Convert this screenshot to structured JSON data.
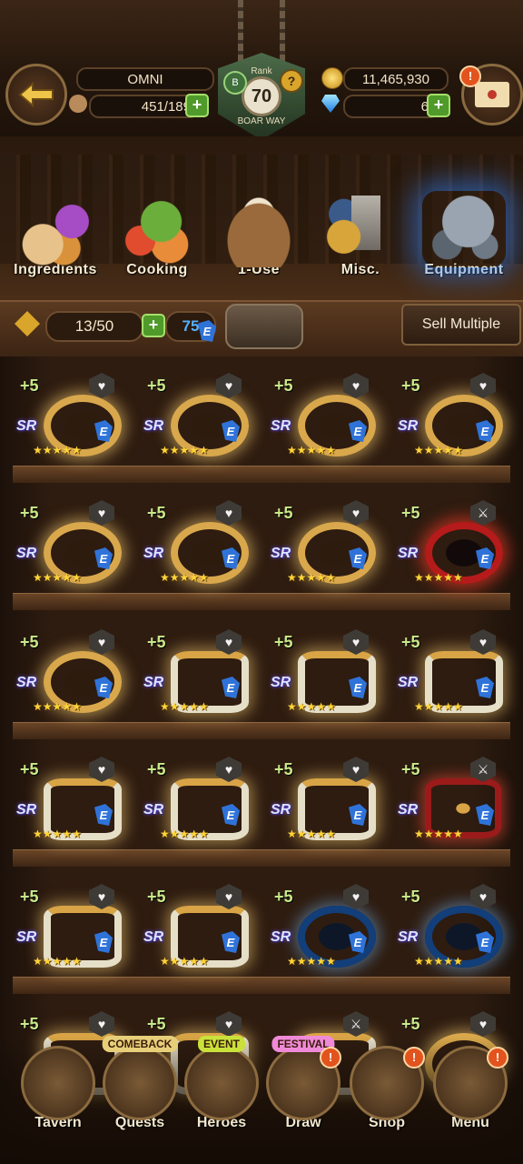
{
  "header": {
    "player_name": "OMNI",
    "stamina": "451/189",
    "gold": "11,465,930",
    "gems": "6",
    "rank_label": "Rank",
    "rank_value": "70",
    "rank_sub": "BOAR WAY",
    "rank_bonus": "B",
    "help_glyph": "?",
    "alert_glyph": "!"
  },
  "categories": [
    {
      "label": "Ingredients",
      "icon": "ingredients-icon"
    },
    {
      "label": "Cooking",
      "icon": "cooking-icon"
    },
    {
      "label": "1-Use",
      "icon": "bag-icon"
    },
    {
      "label": "Misc.",
      "icon": "trophy-icon"
    },
    {
      "label": "Equipment",
      "icon": "armor-icon",
      "active": true
    }
  ],
  "inventory": {
    "capacity": "13/50",
    "essence": "75",
    "essence_tag": "E",
    "sell_multiple_label": "Sell Multiple"
  },
  "items": [
    {
      "level": "+5",
      "type": "ring-gold",
      "grade": "SR",
      "elem": "E",
      "stars": "★★★★★",
      "lock": "♥"
    },
    {
      "level": "+5",
      "type": "ring-gold",
      "grade": "SR",
      "elem": "E",
      "stars": "★★★★★",
      "lock": "♥"
    },
    {
      "level": "+5",
      "type": "ring-gold",
      "grade": "SR",
      "elem": "E",
      "stars": "★★★★★",
      "lock": "♥"
    },
    {
      "level": "+5",
      "type": "ring-gold",
      "grade": "SR",
      "elem": "E",
      "stars": "★★★★★",
      "lock": "♥"
    },
    {
      "level": "+5",
      "type": "ring-gold",
      "grade": "SR",
      "elem": "E",
      "stars": "★★★★★",
      "lock": "♥"
    },
    {
      "level": "+5",
      "type": "ring-gold",
      "grade": "SR",
      "elem": "E",
      "stars": "★★★★★",
      "lock": "♥"
    },
    {
      "level": "+5",
      "type": "ring-gold",
      "grade": "SR",
      "elem": "E",
      "stars": "★★★★★",
      "lock": "♥"
    },
    {
      "level": "+5",
      "type": "ring-red",
      "grade": "SR",
      "elem": "E",
      "stars": "★★★★★",
      "lock": "⚔"
    },
    {
      "level": "+5",
      "type": "ring-gold",
      "grade": "SR",
      "elem": "E",
      "stars": "★★★★★",
      "lock": "♥"
    },
    {
      "level": "+5",
      "type": "bangle",
      "grade": "SR",
      "elem": "E",
      "stars": "★★★★★",
      "lock": "♥"
    },
    {
      "level": "+5",
      "type": "bangle",
      "grade": "SR",
      "elem": "E",
      "stars": "★★★★★",
      "lock": "♥"
    },
    {
      "level": "+5",
      "type": "bangle",
      "grade": "SR",
      "elem": "E",
      "stars": "★★★★★",
      "lock": "♥"
    },
    {
      "level": "+5",
      "type": "bangle",
      "grade": "SR",
      "elem": "E",
      "stars": "★★★★★",
      "lock": "♥"
    },
    {
      "level": "+5",
      "type": "bangle",
      "grade": "SR",
      "elem": "E",
      "stars": "★★★★★",
      "lock": "♥"
    },
    {
      "level": "+5",
      "type": "bangle",
      "grade": "SR",
      "elem": "E",
      "stars": "★★★★★",
      "lock": "♥"
    },
    {
      "level": "+5",
      "type": "bangle-red",
      "grade": "SR",
      "elem": "E",
      "stars": "★★★★★",
      "lock": "⚔"
    },
    {
      "level": "+5",
      "type": "bangle",
      "grade": "SR",
      "elem": "E",
      "stars": "★★★★★",
      "lock": "♥"
    },
    {
      "level": "+5",
      "type": "bangle",
      "grade": "SR",
      "elem": "E",
      "stars": "★★★★★",
      "lock": "♥"
    },
    {
      "level": "+5",
      "type": "ring-blue",
      "grade": "SR",
      "elem": "E",
      "stars": "★★★★★",
      "lock": "♥"
    },
    {
      "level": "+5",
      "type": "ring-blue",
      "grade": "SR",
      "elem": "E",
      "stars": "★★★★★",
      "lock": "♥"
    },
    {
      "level": "+5",
      "type": "bangle",
      "grade": "",
      "elem": "",
      "stars": "",
      "lock": "♥"
    },
    {
      "level": "+5",
      "type": "bangle",
      "grade": "",
      "elem": "",
      "stars": "",
      "lock": "♥"
    },
    {
      "level": "",
      "type": "bangle",
      "grade": "",
      "elem": "",
      "stars": "",
      "lock": "⚔"
    },
    {
      "level": "+5",
      "type": "ring-gold",
      "grade": "",
      "elem": "",
      "stars": "",
      "lock": "♥"
    }
  ],
  "nav": [
    {
      "label": "Tavern",
      "tag": "",
      "icon": "tavern-icon",
      "alert": false
    },
    {
      "label": "Quests",
      "tag": "COMEBACK",
      "icon": "scroll-icon",
      "alert": false
    },
    {
      "label": "Heroes",
      "tag": "EVENT",
      "icon": "helmet-icon",
      "alert": false
    },
    {
      "label": "Draw",
      "tag": "FESTIVAL",
      "icon": "crystal-icon",
      "alert": true
    },
    {
      "label": "Shop",
      "tag": "",
      "icon": "shop-icon",
      "alert": true
    },
    {
      "label": "Menu",
      "tag": "",
      "icon": "gear-icon",
      "alert": true
    }
  ],
  "colors": {
    "accent_green": "#4f9a2a",
    "level_text": "#c9e98a",
    "star": "#ffd43a",
    "alert": "#e2531e",
    "equipment_glow": "#2d82ff"
  }
}
